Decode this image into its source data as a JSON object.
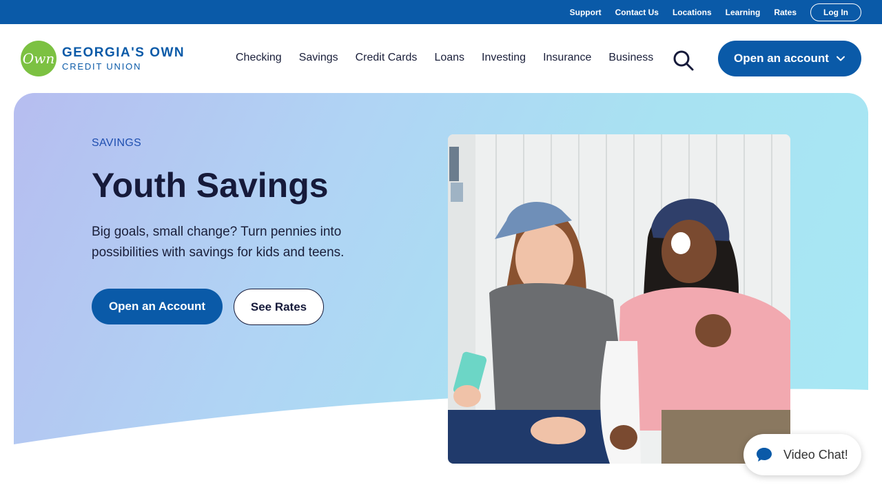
{
  "utility_nav": {
    "links": [
      "Support",
      "Contact Us",
      "Locations",
      "Learning",
      "Rates"
    ],
    "login_label": "Log In"
  },
  "brand": {
    "logo_mark": "Own",
    "name_line1": "GEORGIA'S OWN",
    "name_line2": "CREDIT UNION"
  },
  "main_nav": {
    "items": [
      "Checking",
      "Savings",
      "Credit Cards",
      "Loans",
      "Investing",
      "Insurance",
      "Business"
    ],
    "open_account_label": "Open an account"
  },
  "hero": {
    "eyebrow": "SAVINGS",
    "title": "Youth Savings",
    "description": "Big goals, small change? Turn pennies into possibilities with savings for kids and teens.",
    "primary_cta": "Open an Account",
    "secondary_cta": "See Rates"
  },
  "video_chat": {
    "label": "Video Chat!"
  },
  "colors": {
    "brand_blue": "#0a5aa8",
    "logo_green": "#7cc142",
    "heading_navy": "#161a3a"
  }
}
